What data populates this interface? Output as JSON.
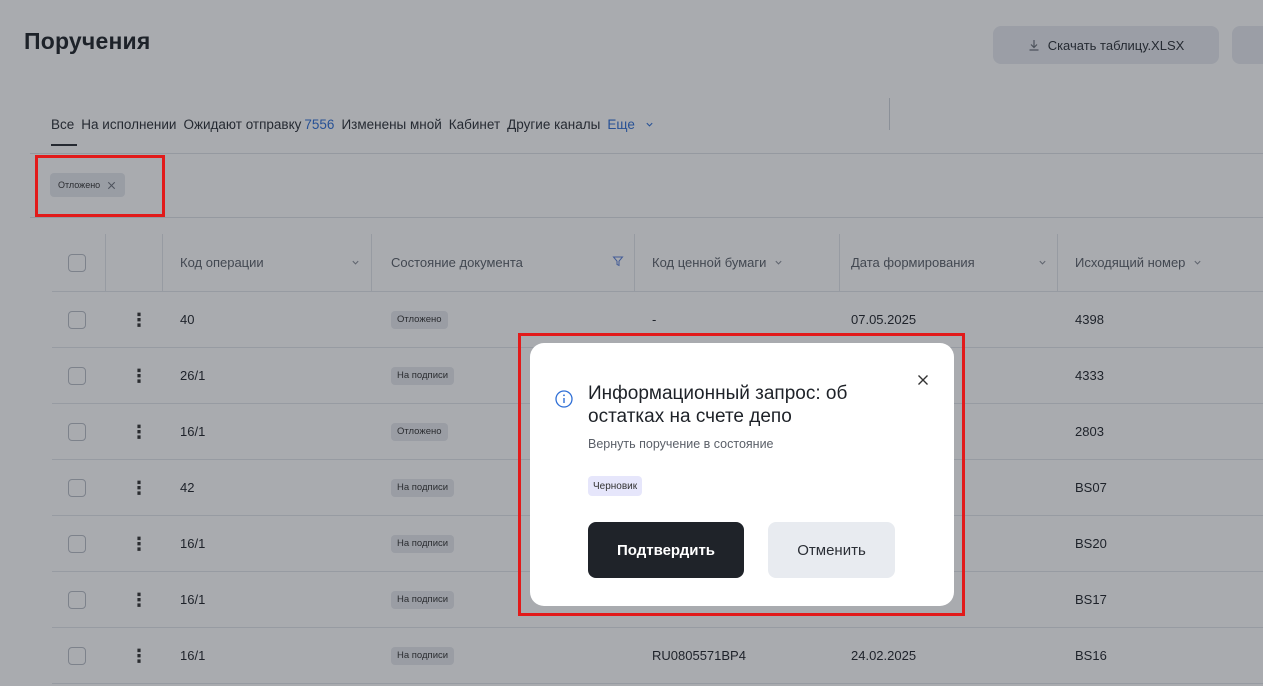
{
  "page": {
    "title": "Поручения",
    "download_button": "Скачать таблицу.XLSX"
  },
  "tabs": {
    "all": "Все",
    "in_progress": "На исполнении",
    "awaiting_send": "Ожидают отправку",
    "awaiting_send_count": "7556",
    "changed_by_me": "Изменены мной",
    "cabinet": "Кабинет",
    "other_channels": "Другие каналы",
    "more": "Еще"
  },
  "filter_chip": {
    "label": "Отложено"
  },
  "table": {
    "columns": [
      "Код операции",
      "Состояние документа",
      "Код ценной бумаги",
      "Дата формирования",
      "Исходящий номер"
    ],
    "rows": [
      {
        "op": "40",
        "state": "Отложено",
        "security": "-",
        "date": "07.05.2025",
        "out": "4398"
      },
      {
        "op": "26/1",
        "state": "На подписи",
        "security": "",
        "date": "",
        "out": "4333"
      },
      {
        "op": "16/1",
        "state": "Отложено",
        "security": "",
        "date": "",
        "out": "2803"
      },
      {
        "op": "42",
        "state": "На подписи",
        "security": "",
        "date": "",
        "out": "BS07"
      },
      {
        "op": "16/1",
        "state": "На подписи",
        "security": "",
        "date": "",
        "out": "BS20"
      },
      {
        "op": "16/1",
        "state": "На подписи",
        "security": "",
        "date": "",
        "out": "BS17"
      },
      {
        "op": "16/1",
        "state": "На подписи",
        "security": "RU0805571BP4",
        "date": "24.02.2025",
        "out": "BS16"
      }
    ]
  },
  "modal": {
    "title": "Информационный запрос: об остатках на счете депо",
    "subtitle": "Вернуть поручение в состояние",
    "badge": "Черновик",
    "confirm": "Подтвердить",
    "cancel": "Отменить"
  },
  "icons": {
    "download": "download-icon",
    "close": "close-icon",
    "info": "info-icon",
    "chevron": "chevron-down-icon",
    "filter": "filter-icon",
    "kebab": "kebab-menu-icon"
  },
  "colors": {
    "accent_blue": "#2f6fd6",
    "highlight_red": "#e21a1a",
    "confirm_bg": "#1f2329"
  }
}
